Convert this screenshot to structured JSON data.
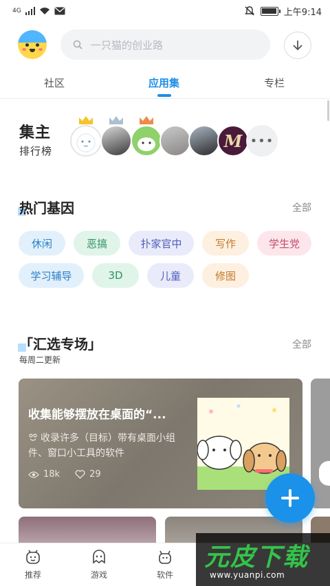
{
  "status_bar": {
    "network": "4G",
    "time": "上午9:14",
    "icons": [
      "signal-icon",
      "wifi-icon",
      "mail-icon",
      "mute-icon",
      "battery-icon"
    ]
  },
  "header": {
    "search_placeholder": "一只猫的创业路",
    "icons": [
      "avatar",
      "search-icon",
      "download-icon"
    ]
  },
  "tabs": [
    {
      "label": "社区",
      "active": false
    },
    {
      "label": "应用集",
      "active": true
    },
    {
      "label": "专栏",
      "active": false
    }
  ],
  "leaderboard": {
    "title_big": "集主",
    "title_small": "排行榜",
    "more_icon": "more-dots-icon"
  },
  "hot_genes": {
    "title": "热门基因",
    "more": "全部",
    "tags": [
      "休闲",
      "恶搞",
      "扑家官中",
      "写作",
      "学生党",
      "学习辅导",
      "3D",
      "儿童",
      "修图"
    ]
  },
  "featured": {
    "title": "「汇选专场」",
    "subtitle": "每周二更新",
    "more": "全部",
    "card": {
      "title": "收集能够摆放在桌面的“...",
      "desc": "收录许多（目标）带有桌面小组件、窗口小工具的软件",
      "views": "18k",
      "likes": "29"
    }
  },
  "bottom_nav": [
    {
      "label": "推荐",
      "icon": "recommend-icon"
    },
    {
      "label": "游戏",
      "icon": "game-icon"
    },
    {
      "label": "软件",
      "icon": "software-icon"
    }
  ],
  "watermark": {
    "brand": "元皮下载",
    "url": "www.yuanpi.com"
  },
  "colors": {
    "accent": "#1c8ee6",
    "fab": "#1a92ea",
    "watermark_green": "#33c449"
  }
}
